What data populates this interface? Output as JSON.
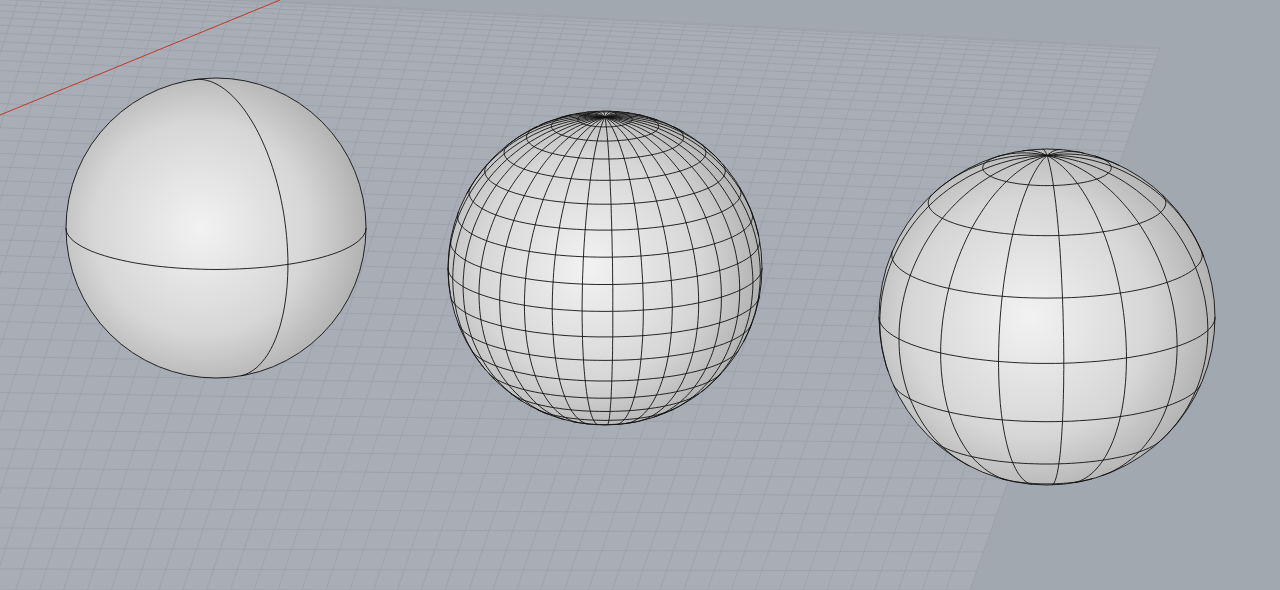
{
  "viewport": {
    "objects": [
      {
        "kind": "surface"
      },
      {
        "kind": "fine-mesh"
      },
      {
        "kind": "coarse-mesh"
      }
    ]
  }
}
